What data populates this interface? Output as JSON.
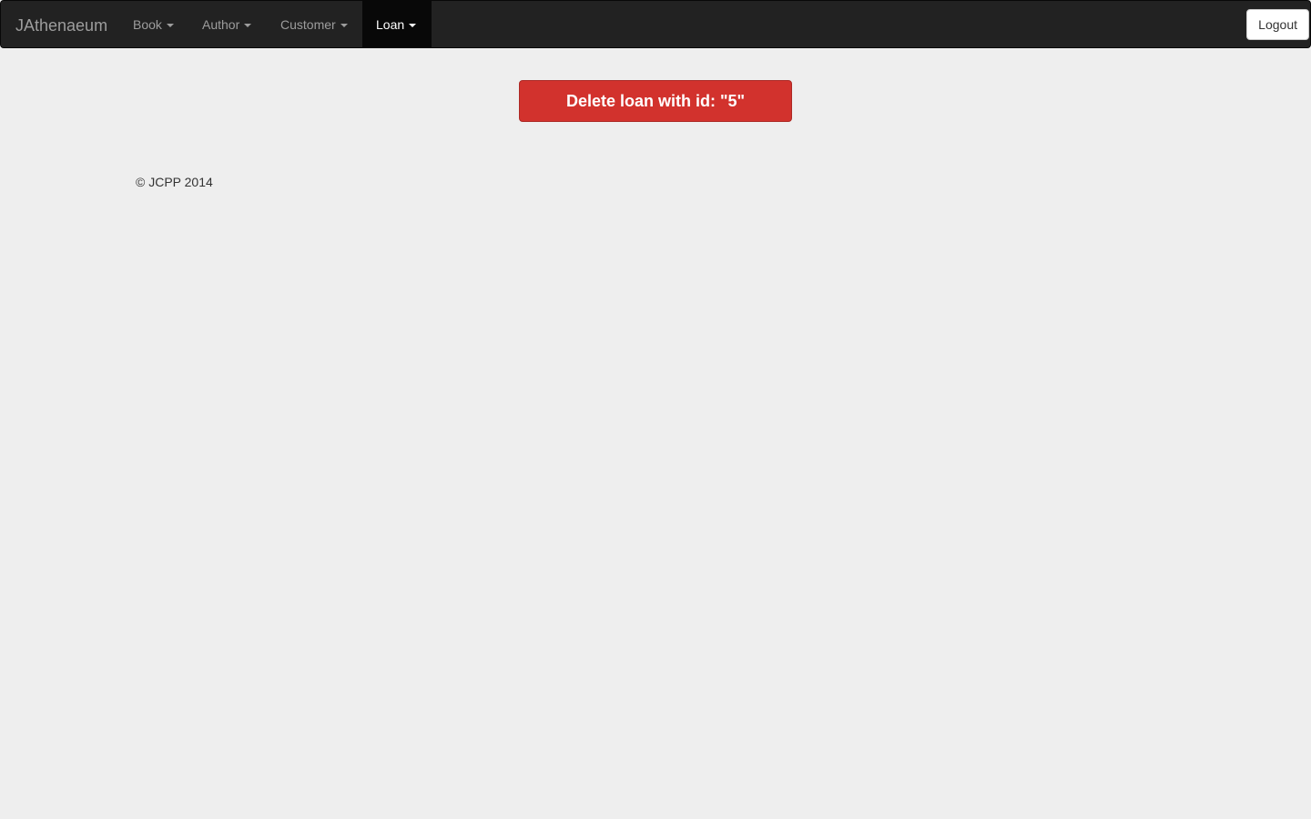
{
  "navbar": {
    "brand": "JAthenaeum",
    "items": [
      {
        "label": "Book",
        "active": false
      },
      {
        "label": "Author",
        "active": false
      },
      {
        "label": "Customer",
        "active": false
      },
      {
        "label": "Loan",
        "active": true
      }
    ],
    "logout_label": "Logout"
  },
  "main": {
    "delete_button_label": "Delete loan with id: \"5\""
  },
  "footer": {
    "text": "© JCPP 2014"
  },
  "colors": {
    "navbar_bg": "#222222",
    "page_bg": "#eeeeee",
    "danger": "#d2322d"
  }
}
